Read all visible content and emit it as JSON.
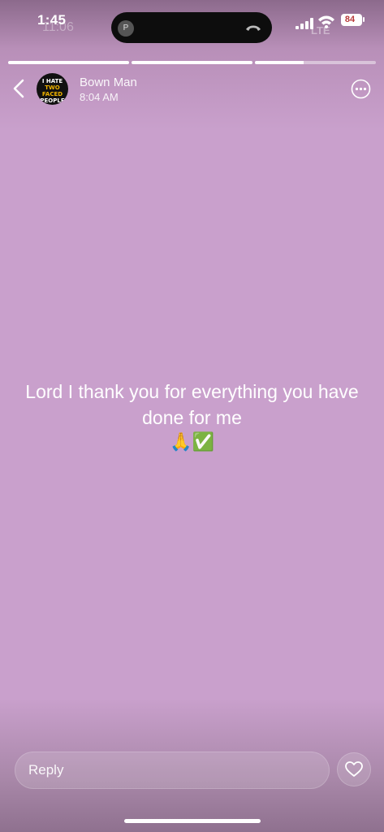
{
  "status_bar": {
    "time": "1:45",
    "ghost_time": "11:06",
    "island_avatar_letter": "P",
    "battery": "84",
    "ghost_network": "LTE"
  },
  "story": {
    "progress": [
      1.0,
      1.0,
      0.4
    ],
    "author": "Bown Man",
    "time": "8:04 AM",
    "avatar_text": [
      "I HATE",
      "TWO FACED",
      "PEOPLE"
    ],
    "message": "Lord I thank you for everything you have done for me",
    "emoji": "🙏✅",
    "background_color": "#c9a0cc"
  },
  "reply": {
    "placeholder": "Reply"
  },
  "icons": {
    "back": "chevron-left-icon",
    "more": "more-horizontal-icon",
    "like": "heart-icon"
  }
}
